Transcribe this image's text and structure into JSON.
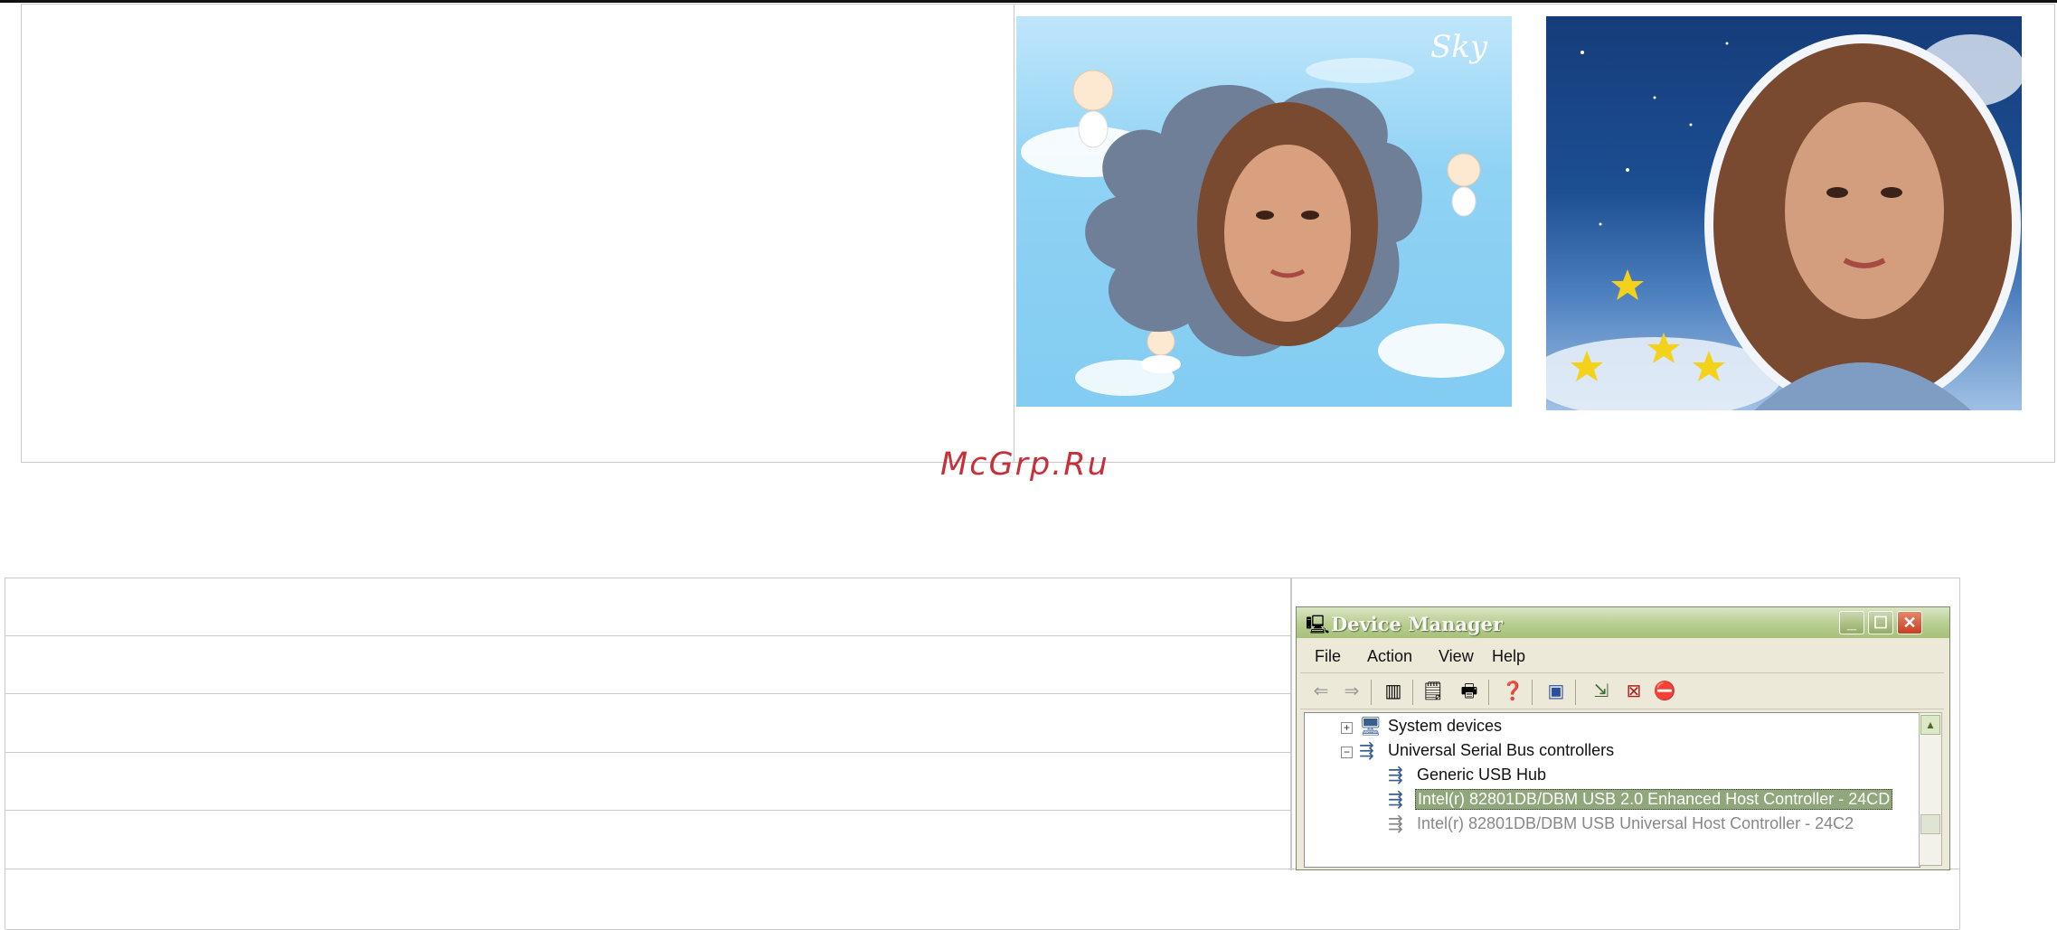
{
  "watermark": "McGrp.Ru",
  "top_photos": [
    {
      "name": "sky-cloud-frame",
      "caption": "Sky"
    },
    {
      "name": "night-oval-frame"
    }
  ],
  "device_manager": {
    "title": "Device Manager",
    "menu": [
      "File",
      "Action",
      "View",
      "Help"
    ],
    "toolbar_icons": [
      "back-arrow-icon",
      "forward-arrow-icon",
      "tree-view-icon",
      "properties-icon",
      "print-icon",
      "help-icon",
      "scan-hardware-icon",
      "update-driver-icon",
      "uninstall-icon",
      "disable-icon"
    ],
    "tree": [
      {
        "label": "System devices",
        "expander": "+",
        "level": 0
      },
      {
        "label": "Universal Serial Bus controllers",
        "expander": "−",
        "level": 0
      },
      {
        "label": "Generic USB Hub",
        "level": 1
      },
      {
        "label": "Intel(r) 82801DB/DBM USB 2.0 Enhanced Host Controller - 24CD",
        "level": 1,
        "selected": true
      },
      {
        "label": "Intel(r) 82801DB/DBM USB Universal Host Controller - 24C2",
        "level": 1
      }
    ]
  }
}
